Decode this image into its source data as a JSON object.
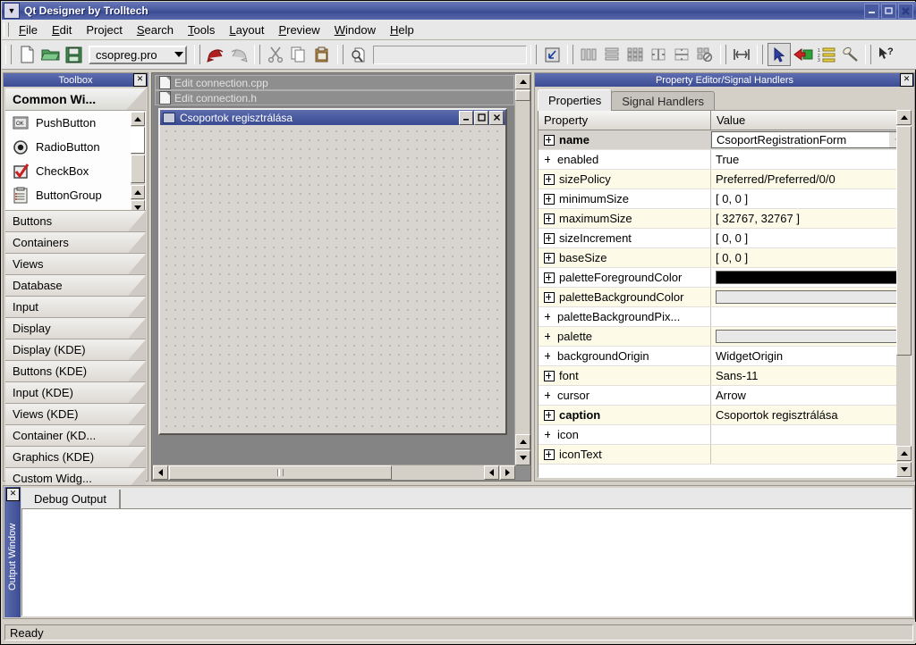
{
  "window": {
    "title": "Qt Designer by Trolltech",
    "menu_icon": "chevron-down-icon",
    "controls": [
      {
        "name": "minimize-button",
        "glyph": "–"
      },
      {
        "name": "maximize-button",
        "glyph": "❐"
      },
      {
        "name": "close-button",
        "glyph": "✖"
      }
    ]
  },
  "menubar": {
    "items": [
      {
        "label": "File",
        "mnemonic": "F"
      },
      {
        "label": "Edit",
        "mnemonic": "E"
      },
      {
        "label": "Project",
        "mnemonic": "j"
      },
      {
        "label": "Search",
        "mnemonic": "S"
      },
      {
        "label": "Tools",
        "mnemonic": "T"
      },
      {
        "label": "Layout",
        "mnemonic": "L"
      },
      {
        "label": "Preview",
        "mnemonic": "P"
      },
      {
        "label": "Window",
        "mnemonic": "W"
      },
      {
        "label": "Help",
        "mnemonic": "H"
      }
    ]
  },
  "toolbar": {
    "project_combo_value": "csopreg.pro",
    "search_value": "",
    "buttons": [
      "new-file-icon",
      "open-folder-icon",
      "save-icon",
      "undo-icon",
      "redo-icon",
      "cut-icon",
      "copy-icon",
      "paste-icon",
      "find-icon",
      "adjust-size-icon",
      "layout-horizontal-icon",
      "layout-vertical-icon",
      "layout-grid-icon",
      "split-horizontal-icon",
      "split-vertical-icon",
      "break-layout-icon",
      "add-spacer-icon",
      "pointer-tool-icon",
      "connect-signals-icon",
      "tab-order-icon",
      "buddy-edit-icon",
      "whats-this-icon"
    ]
  },
  "toolbox": {
    "title": "Toolbox",
    "close_icon": "close-icon",
    "current_page": "Common Wi...",
    "widgets": [
      {
        "label": "PushButton",
        "icon": "pushbutton-icon"
      },
      {
        "label": "RadioButton",
        "icon": "radiobutton-icon"
      },
      {
        "label": "CheckBox",
        "icon": "checkbox-icon"
      },
      {
        "label": "ButtonGroup",
        "icon": "buttongroup-icon"
      }
    ],
    "categories": [
      "Buttons",
      "Containers",
      "Views",
      "Database",
      "Input",
      "Display",
      "Display (KDE)",
      "Buttons (KDE)",
      "Input (KDE)",
      "Views (KDE)",
      "Container (KD...",
      "Graphics (KDE)",
      "Custom Widg..."
    ]
  },
  "workspace": {
    "background_windows": [
      {
        "title": "Edit connection.cpp",
        "icon": "document-icon"
      },
      {
        "title": "Edit connection.h",
        "icon": "document-icon"
      }
    ],
    "form_window": {
      "title": "Csoportok regisztrálása",
      "icon": "form-icon",
      "buttons": [
        {
          "name": "form-minimize-button",
          "glyph": "_"
        },
        {
          "name": "form-maximize-button",
          "glyph": "□"
        },
        {
          "name": "form-close-button",
          "glyph": "✕"
        }
      ]
    }
  },
  "property_editor": {
    "title": "Property Editor/Signal Handlers",
    "close_icon": "close-icon",
    "tabs": [
      {
        "label": "Properties",
        "selected": true
      },
      {
        "label": "Signal Handlers",
        "selected": false
      }
    ],
    "columns": [
      "Property",
      "Value"
    ],
    "rows": [
      {
        "property": "name",
        "value": "CsoportRegistrationForm",
        "expandable": true,
        "bold": true,
        "selected": true,
        "revert": true
      },
      {
        "property": "enabled",
        "value": "True",
        "expandable": false
      },
      {
        "property": "sizePolicy",
        "value": "Preferred/Preferred/0/0",
        "expandable": true
      },
      {
        "property": "minimumSize",
        "value": "[ 0, 0 ]",
        "expandable": true
      },
      {
        "property": "maximumSize",
        "value": "[ 32767, 32767 ]",
        "expandable": true
      },
      {
        "property": "sizeIncrement",
        "value": "[ 0, 0 ]",
        "expandable": true
      },
      {
        "property": "baseSize",
        "value": "[ 0, 0 ]",
        "expandable": true
      },
      {
        "property": "paletteForegroundColor",
        "value": "",
        "expandable": true,
        "swatch": "#000000"
      },
      {
        "property": "paletteBackgroundColor",
        "value": "",
        "expandable": true,
        "swatch": "#e8e8e8"
      },
      {
        "property": "paletteBackgroundPix...",
        "value": "",
        "expandable": false
      },
      {
        "property": "palette",
        "value": "",
        "expandable": false,
        "swatch": "#e8e8e8"
      },
      {
        "property": "backgroundOrigin",
        "value": "WidgetOrigin",
        "expandable": false
      },
      {
        "property": "font",
        "value": "Sans-11",
        "expandable": true
      },
      {
        "property": "cursor",
        "value": "Arrow",
        "expandable": false
      },
      {
        "property": "caption",
        "value": "Csoportok regisztrálása",
        "expandable": true,
        "bold": true
      },
      {
        "property": "icon",
        "value": "",
        "expandable": false
      },
      {
        "property": "iconText",
        "value": "",
        "expandable": true
      }
    ]
  },
  "output_window": {
    "title": "Output Window",
    "close_icon": "close-icon",
    "tabs": [
      {
        "label": "Debug Output",
        "selected": true
      }
    ],
    "content": ""
  },
  "statusbar": {
    "message": "Ready"
  },
  "colors": {
    "titlebar_blue": "#3c4c94",
    "panel_face": "#d4d0c8",
    "row_alt": "#fdfbe8",
    "row_selected": "#d6d2ce"
  }
}
